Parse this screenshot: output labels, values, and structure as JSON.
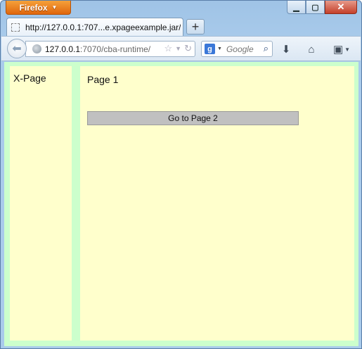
{
  "browser": {
    "app_button": "Firefox",
    "tab": {
      "title": "http://127.0.0.1:707...e.xpageexample.jar/"
    },
    "url": {
      "host": "127.0.0.1",
      "rest": ":7070/cba-runtime/"
    },
    "search": {
      "placeholder": "Google"
    }
  },
  "page": {
    "sidebar_title": "X-Page",
    "main_title": "Page 1",
    "goto_button": "Go to Page 2"
  },
  "colors": {
    "panel_bg": "#ffffcc",
    "frame_bg": "#ccffcc",
    "button_bg": "#c0c0c0"
  }
}
